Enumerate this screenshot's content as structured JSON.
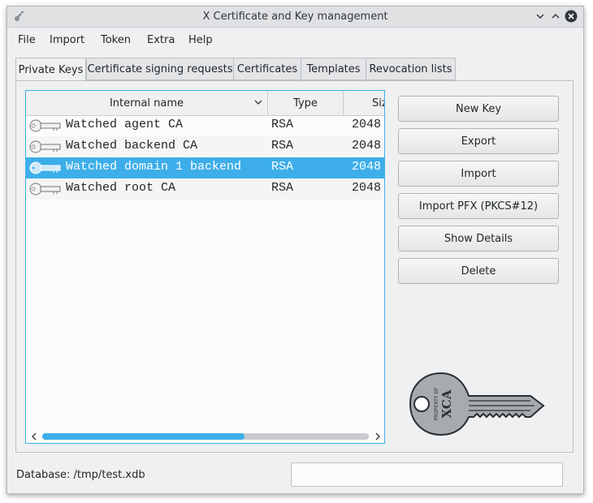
{
  "window": {
    "title": "X Certificate and Key management"
  },
  "menu": [
    "File",
    "Import",
    "Token",
    "Extra",
    "Help"
  ],
  "tabs": [
    "Private Keys",
    "Certificate signing requests",
    "Certificates",
    "Templates",
    "Revocation lists"
  ],
  "table": {
    "columns": [
      "Internal name",
      "Type",
      "Siz"
    ],
    "rows": [
      {
        "name": "Watched agent CA",
        "type": "RSA",
        "size": "2048"
      },
      {
        "name": "Watched backend CA",
        "type": "RSA",
        "size": "2048"
      },
      {
        "name": "Watched domain 1 backend",
        "type": "RSA",
        "size": "2048"
      },
      {
        "name": "Watched root CA",
        "type": "RSA",
        "size": "2048"
      }
    ],
    "selected_row": 2,
    "horizontal_scroll_fraction": 0.62
  },
  "buttons": [
    "New Key",
    "Export",
    "Import",
    "Import PFX (PKCS#12)",
    "Show Details",
    "Delete"
  ],
  "status": {
    "database_label": "Database: /tmp/test.xdb",
    "message": ""
  },
  "logo": {
    "text_small": "PROPERTY OF",
    "text_large": "XCA"
  },
  "colors": {
    "accent": "#3daee9",
    "window_bg": "#eff0f1",
    "selection_text": "#ffffff"
  }
}
